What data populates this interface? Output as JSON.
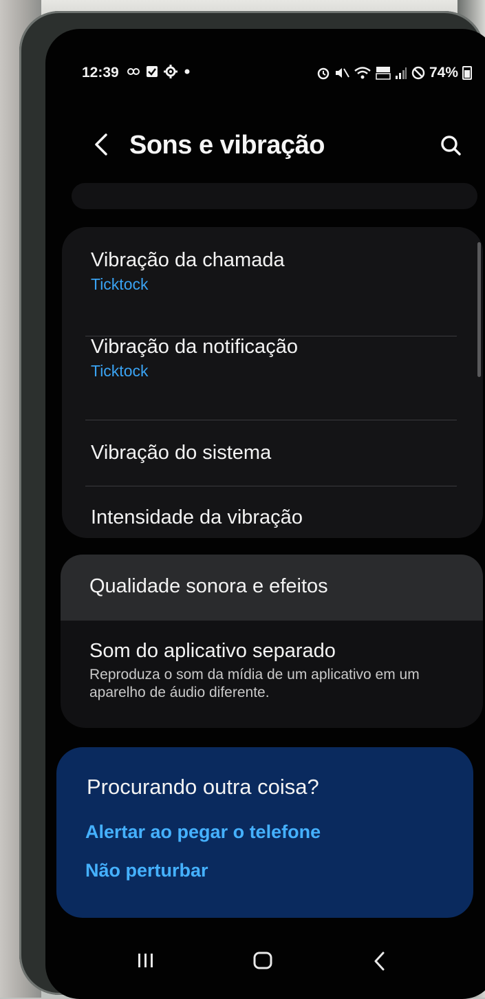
{
  "status_bar": {
    "time": "12:39",
    "battery": "74%",
    "notification_icons": [
      "assistant-icon",
      "checkbox-icon",
      "settings-gear-icon",
      "dot-icon"
    ],
    "system_icons": [
      "alarm-icon",
      "mute-icon",
      "wifi-icon",
      "volte-lte-icon",
      "signal-icon",
      "block-icon",
      "battery-icon"
    ]
  },
  "header": {
    "title": "Sons e vibração"
  },
  "vibration_section": {
    "items": [
      {
        "title": "Vibração da chamada",
        "subtitle": "Ticktock"
      },
      {
        "title": "Vibração da notificação",
        "subtitle": "Ticktock"
      },
      {
        "title": "Vibração do sistema"
      },
      {
        "title": "Intensidade da vibração"
      }
    ]
  },
  "audio_section": {
    "items": [
      {
        "title": "Qualidade sonora e efeitos"
      },
      {
        "title": "Som do aplicativo separado",
        "description": "Reproduza o som da mídia de um aplicativo em um aparelho de áudio diferente."
      }
    ]
  },
  "suggestions": {
    "heading": "Procurando outra coisa?",
    "links": [
      "Alertar ao pegar o telefone",
      "Não perturbar"
    ]
  },
  "colors": {
    "accent_blue": "#3aa3f3",
    "suggestion_card": "#0a2a5e",
    "background": "#020202"
  }
}
